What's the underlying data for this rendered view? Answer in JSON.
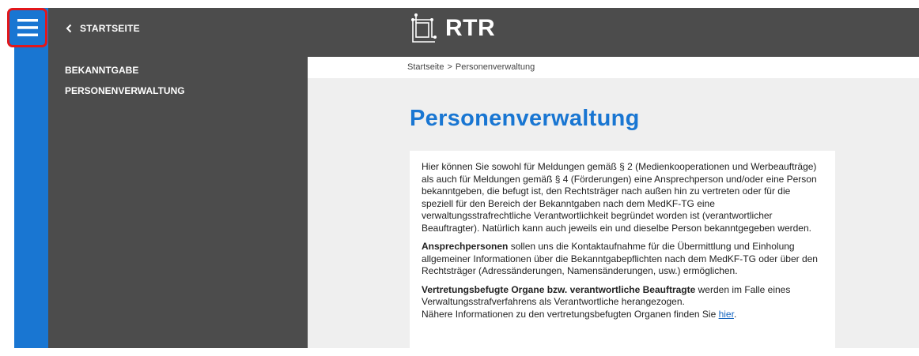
{
  "header": {
    "menu_icon": "hamburger-menu-icon",
    "back_label": "STARTSEITE",
    "logo_text": "RTR"
  },
  "sidebar": {
    "items": [
      {
        "label": "BEKANNTGABE"
      },
      {
        "label": "PERSONENVERWALTUNG"
      }
    ]
  },
  "breadcrumb": {
    "home": "Startseite",
    "separator": ">",
    "current": "Personenverwaltung"
  },
  "page": {
    "title": "Personenverwaltung"
  },
  "content": {
    "intro": "Hier können Sie sowohl für Meldungen gemäß § 2 (Medienkooperationen und Werbeaufträge) als auch für Meldungen gemäß § 4 (Förderungen) eine Ansprechperson und/oder eine Person bekanntgeben, die befugt ist, den Rechtsträger nach außen hin zu vertreten oder für die speziell für den Bereich der Bekanntgaben nach dem MedKF-TG eine verwaltungsstrafrechtliche Verantwortlichkeit begründet worden ist (verantwortlicher Beauftragter). Natürlich kann auch jeweils ein und dieselbe Person bekanntgegeben werden.",
    "p2_bold": "Ansprechpersonen",
    "p2_text": " sollen uns die Kontaktaufnahme für die Übermittlung und Einholung allgemeiner Informationen über die Bekanntgabepflichten nach dem MedKF-TG oder über den Rechtsträger (Adressänderungen, Namensänderungen, usw.) ermöglichen.",
    "p3_bold": "Vertretungsbefugte Organe bzw. verantwortliche Beauftragte",
    "p3_text": " werden im Falle eines Verwaltungsstrafverfahrens als Verantwortliche herangezogen.",
    "p3_line2": "Nähere Informationen zu den vertretungsbefugten Organen finden Sie ",
    "p3_link": "hier",
    "p3_end": "."
  },
  "colors": {
    "accent": "#1976d2",
    "dark_panel": "#4c4c4c",
    "highlight_border": "#e2171b",
    "content_bg": "#efefef"
  }
}
